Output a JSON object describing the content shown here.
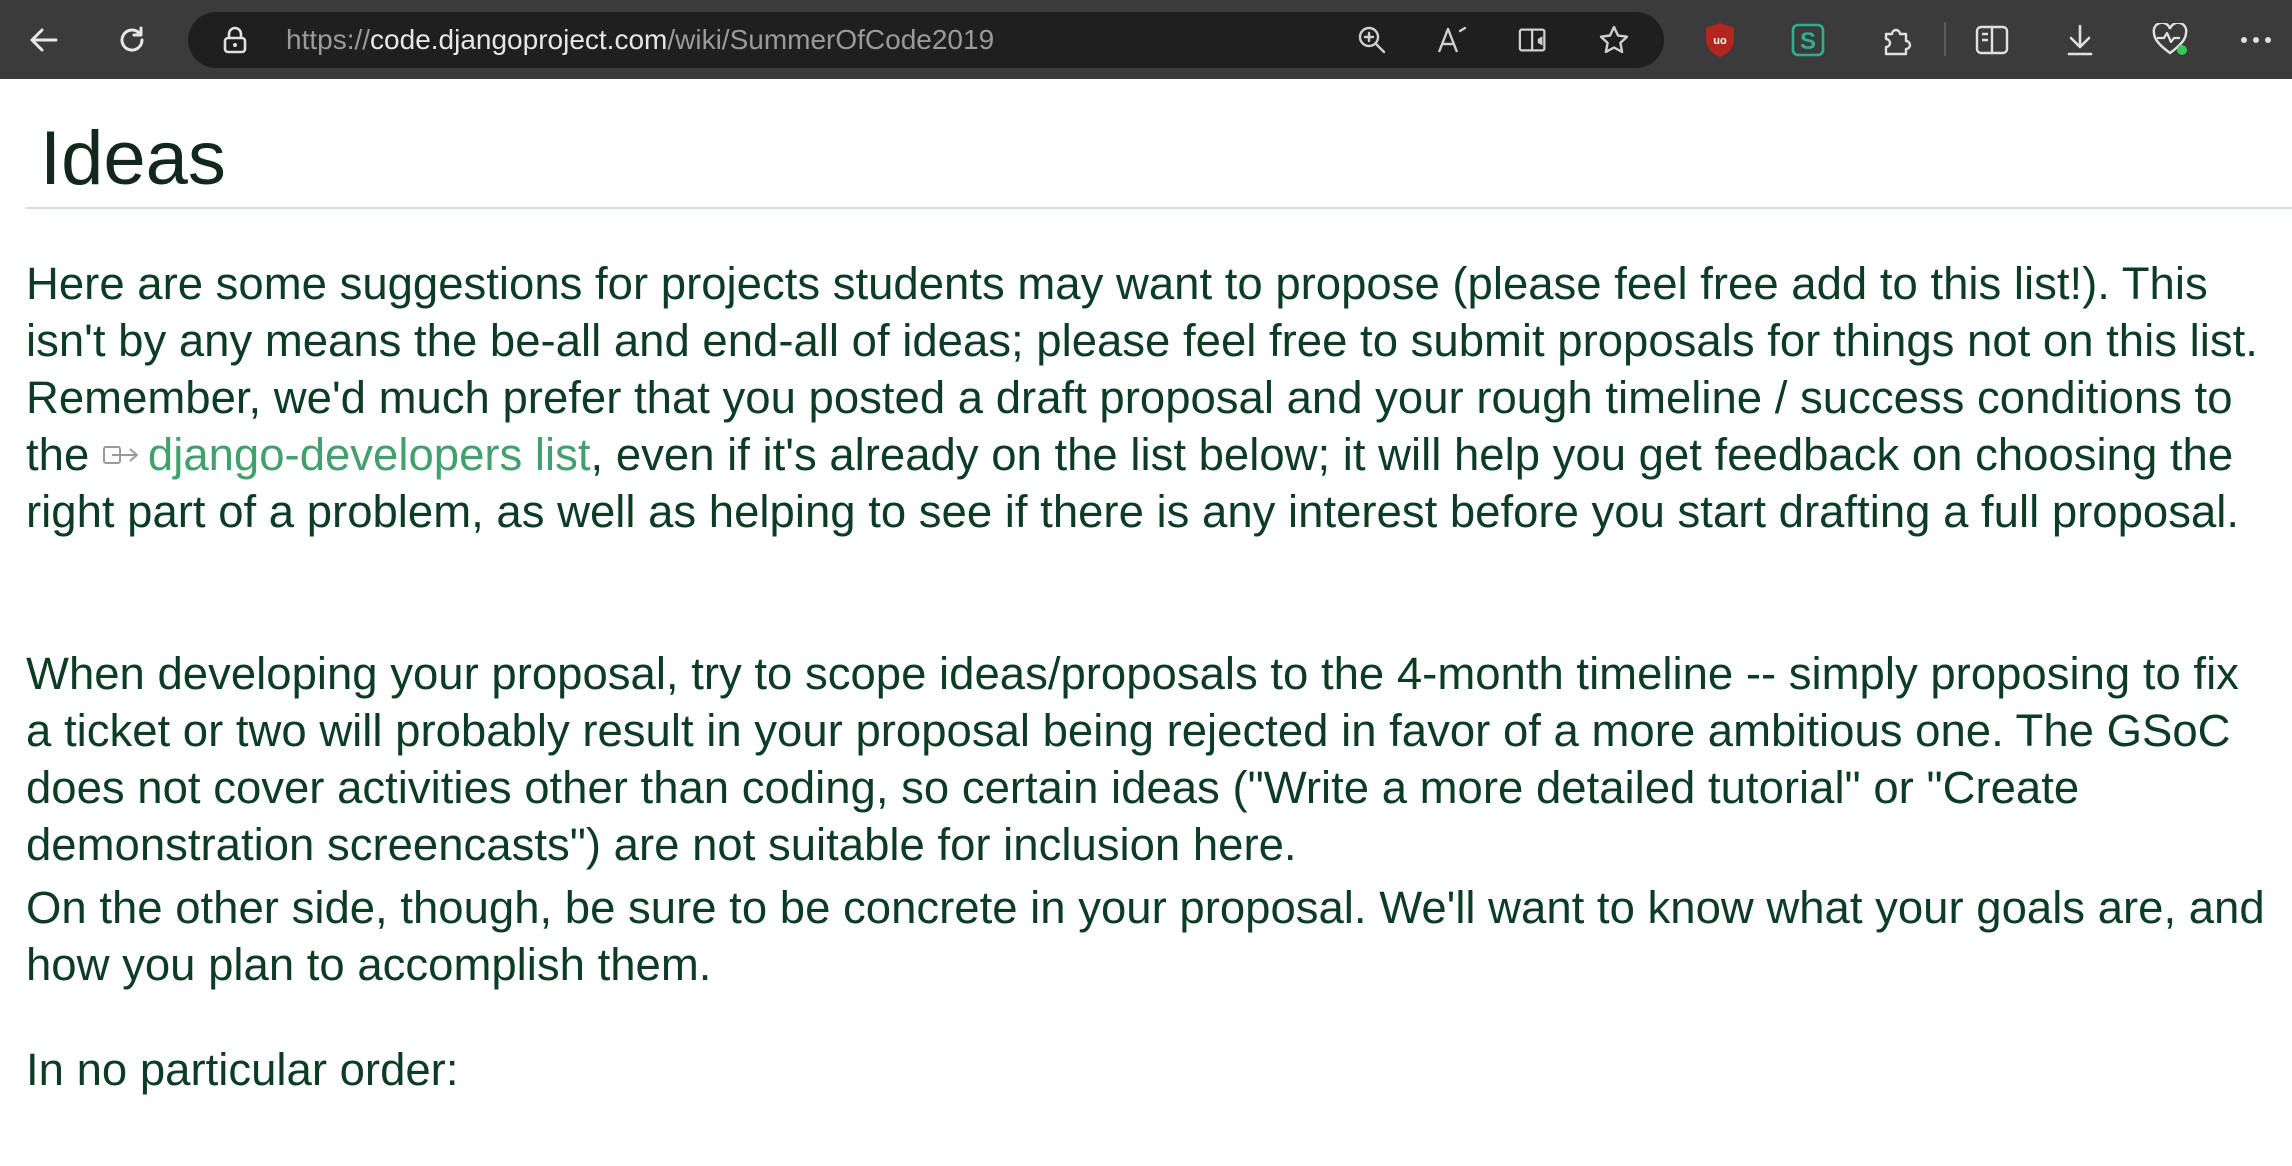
{
  "browser": {
    "url_scheme": "https://",
    "url_host": "code.djangoproject.com",
    "url_path": "/wiki/SummerOfCode2019",
    "icons": [
      "back-icon",
      "refresh-icon",
      "lock-icon",
      "zoom-icon",
      "read-aloud-icon",
      "immersive-reader-icon",
      "favorite-star-icon",
      "ublock-icon",
      "stylus-icon",
      "extensions-icon",
      "split-screen-icon",
      "downloads-icon",
      "browser-health-icon",
      "more-icon"
    ],
    "accent_colors": {
      "toolbar": "#3b3b3b",
      "address_bar": "#1f1f1f",
      "ublock": "#c0392b",
      "stylus": "#2fae8f"
    }
  },
  "page": {
    "title": "Ideas",
    "p1_before": "Here are some suggestions for projects students may want to propose (please feel free add to this list!). This isn't by any means the be-all and end-all of ideas; please feel free to submit proposals for things not on this list. Remember, we'd much prefer that you posted a draft proposal and your rough timeline / success conditions to the ",
    "p1_link": "django-developers list",
    "p1_after": ", even if it's already on the list below; it will help you get feedback on choosing the right part of a problem, as well as helping to see if there is any interest before you start drafting a full proposal.",
    "p2": "When developing your proposal, try to scope ideas/proposals to the 4-month timeline -- simply proposing to fix a ticket or two will probably result in your proposal being rejected in favor of a more ambitious one. The GSoC does not cover activities other than coding, so certain ideas (\"Write a more detailed tutorial\" or \"Create demonstration screencasts\") are not suitable for inclusion here.",
    "p3": "On the other side, though, be sure to be concrete in your proposal. We'll want to know what your goals are, and how you plan to accomplish them.",
    "p4": "In no particular order:",
    "colors": {
      "text": "#0c3c26",
      "link": "#41a06c",
      "title": "#12281f"
    }
  }
}
